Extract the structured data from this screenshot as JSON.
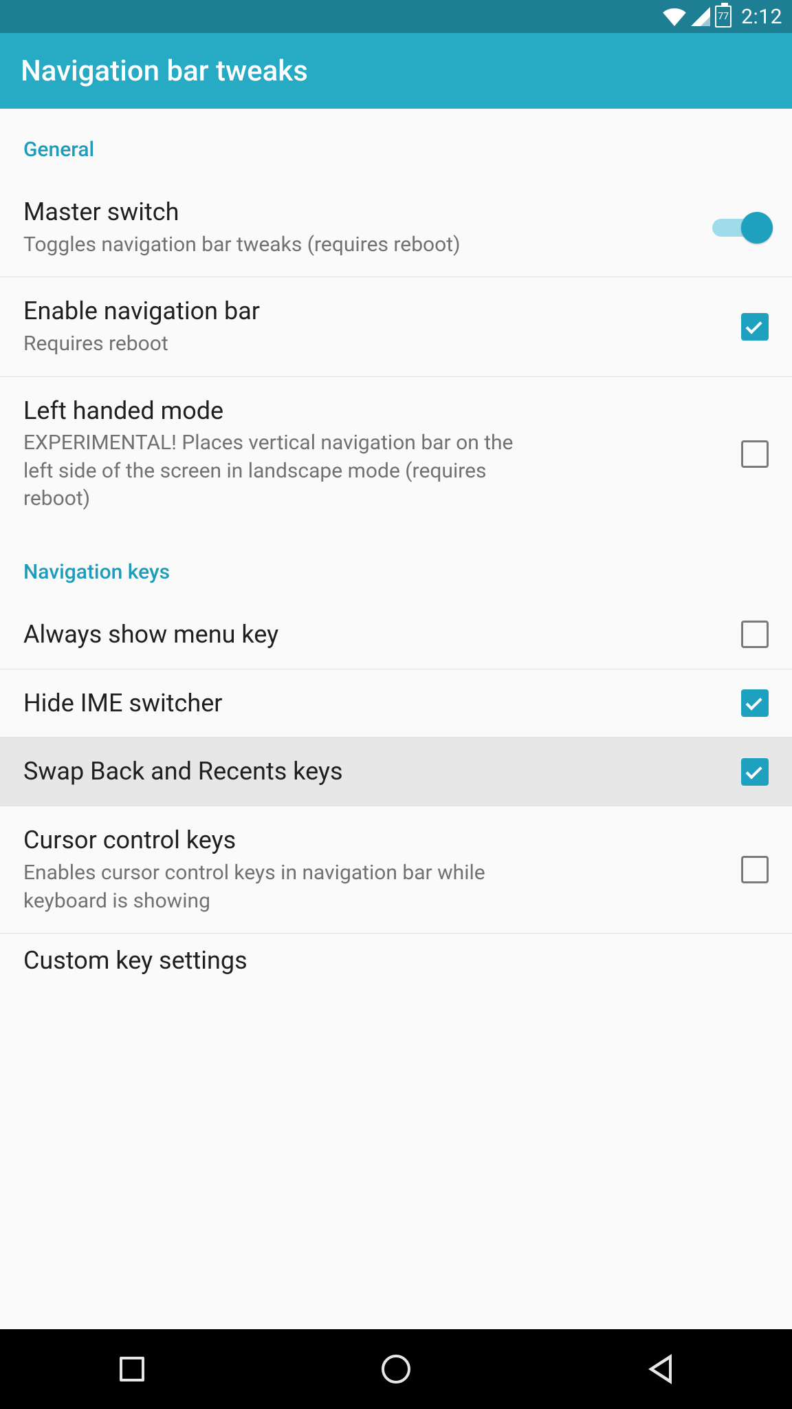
{
  "status": {
    "battery": "77",
    "time": "2:12"
  },
  "appbar": {
    "title": "Navigation bar tweaks"
  },
  "sections": {
    "general": {
      "header": "General",
      "master_switch": {
        "title": "Master switch",
        "sub": "Toggles navigation bar tweaks (requires reboot)",
        "on": true
      },
      "enable_navbar": {
        "title": "Enable navigation bar",
        "sub": "Requires reboot",
        "checked": true
      },
      "left_handed": {
        "title": "Left handed mode",
        "sub": "EXPERIMENTAL! Places vertical navigation bar on the left side of the screen in landscape mode (requires reboot)",
        "checked": false
      }
    },
    "navkeys": {
      "header": "Navigation keys",
      "always_menu": {
        "title": "Always show menu key",
        "checked": false
      },
      "hide_ime": {
        "title": "Hide IME switcher",
        "checked": true
      },
      "swap_back": {
        "title": "Swap Back and Recents keys",
        "checked": true
      },
      "cursor_keys": {
        "title": "Cursor control keys",
        "sub": "Enables cursor control keys in navigation bar while keyboard is showing",
        "checked": false
      },
      "custom_keys": {
        "title": "Custom key settings"
      }
    }
  }
}
